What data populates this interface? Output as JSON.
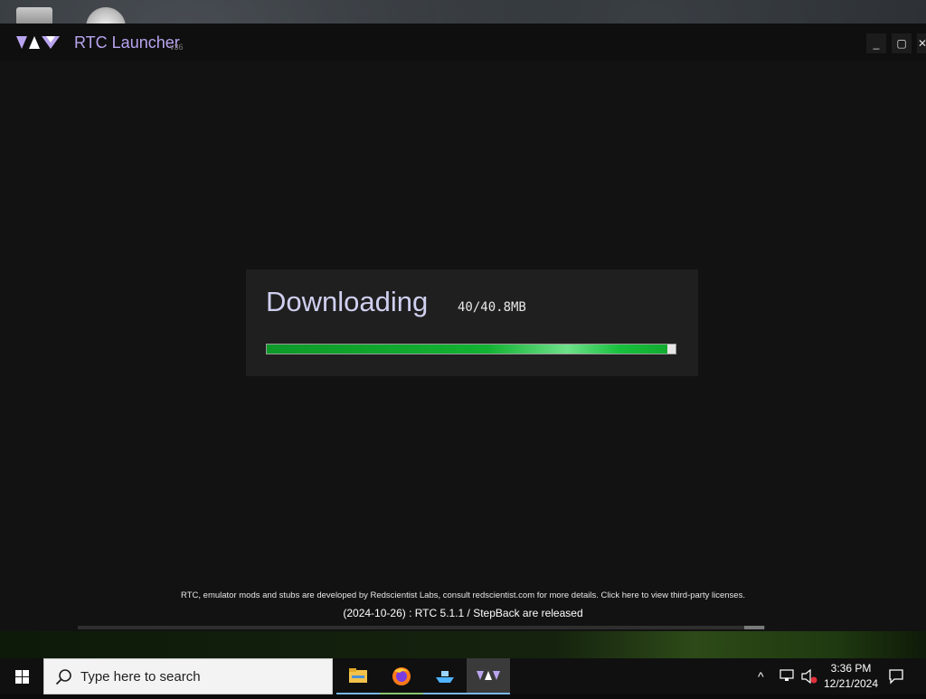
{
  "desktop": {
    "icons": [
      "recycle-bin-icon",
      "disk-icon"
    ]
  },
  "window": {
    "title": "RTC Launcher",
    "version": "v36",
    "controls": {
      "minimize": "_",
      "maximize": "▢",
      "close": "✕"
    }
  },
  "download": {
    "label": "Downloading",
    "size": "40/40.8MB",
    "progress_fraction": 0.98
  },
  "footer": {
    "licenses": "RTC, emulator mods and stubs are developed by Redscientist Labs, consult redscientist.com for more details. Click here to view third-party licenses.",
    "news": "(2024-10-26) : RTC 5.1.1 / StepBack are released"
  },
  "taskbar": {
    "search_placeholder": "Type here to search",
    "apps": [
      "file-explorer-icon",
      "firefox-icon",
      "ship-app-icon",
      "rtc-launcher-icon"
    ],
    "active_app": "rtc-launcher-icon",
    "clock_time": "3:36 PM",
    "clock_date": "12/21/2024"
  },
  "colors": {
    "accent": "#b9a4f0",
    "progress": "#12b232",
    "taskbar_highlight": "#76b9ed"
  }
}
